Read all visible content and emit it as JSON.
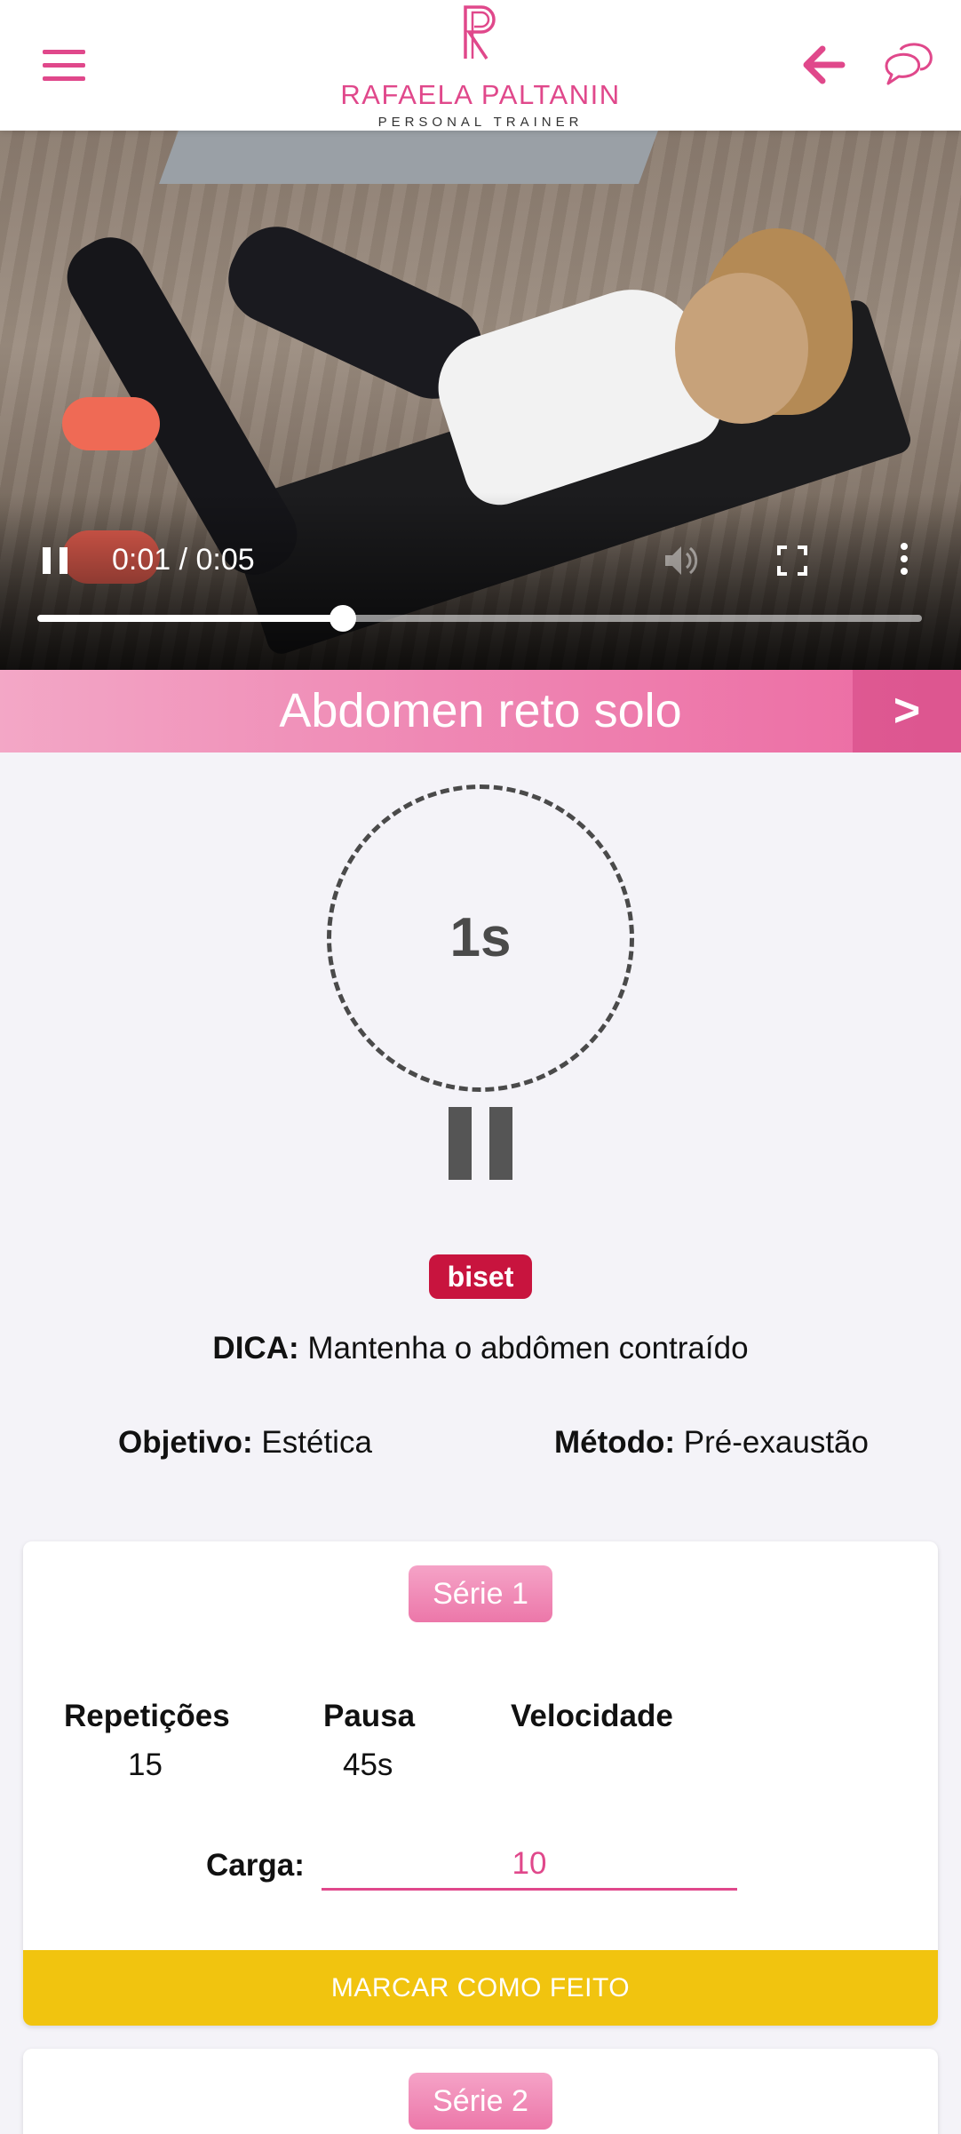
{
  "header": {
    "menu_icon": "hamburger-menu-icon",
    "logo_name": "RAFAELA PALTANIN",
    "logo_subtitle": "PERSONAL TRAINER",
    "back_icon": "arrow-left-icon",
    "chat_icon": "chat-bubble-icon",
    "accent_color": "#e0488b"
  },
  "video": {
    "time_display": "0:01 / 0:05",
    "progress": 0.345,
    "pause_icon": "pause-icon",
    "volume_icon": "volume-icon",
    "fullscreen_icon": "fullscreen-icon",
    "more_icon": "more-vertical-icon"
  },
  "exercise": {
    "title": "Abdomen reto solo",
    "next_label": ">",
    "timer": "1s",
    "badge": "biset",
    "tip_label": "DICA:",
    "tip_text": " Mantenha o abdômen contraído",
    "objective_label": "Objetivo:",
    "objective_value": " Estética",
    "method_label": "Método:",
    "method_value": " Pré-exaustão"
  },
  "series": [
    {
      "label": "Série 1",
      "reps_label": "Repetições",
      "reps_value": "15",
      "pause_label": "Pausa",
      "pause_value": "45s",
      "speed_label": "Velocidade",
      "speed_value": "",
      "load_label": "Carga:",
      "load_value": "10",
      "done_label": "MARCAR COMO FEITO"
    },
    {
      "label": "Série 2"
    }
  ],
  "colors": {
    "badge_red": "#c8143e",
    "done_yellow": "#f1c40f",
    "pink": "#ec77a9"
  }
}
